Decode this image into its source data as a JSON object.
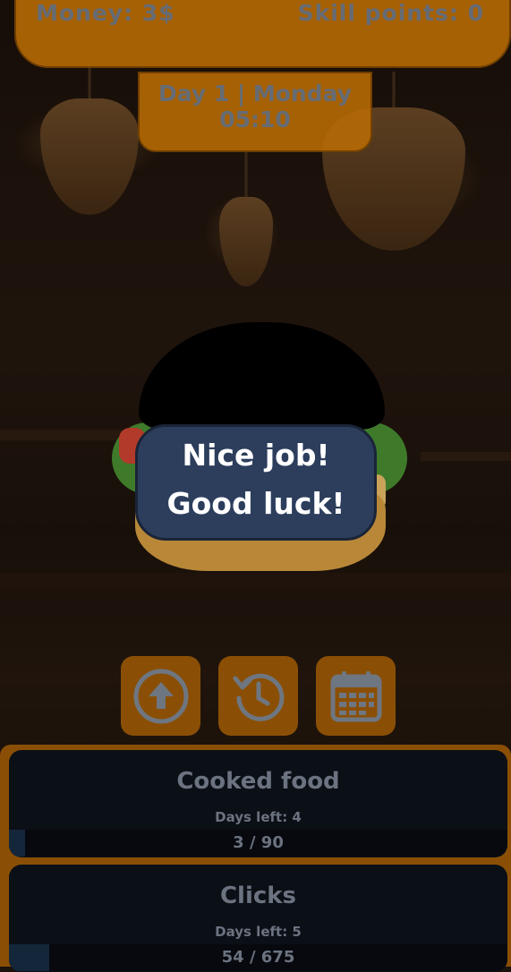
{
  "hud": {
    "money": "Money: 3$",
    "skill_points": "Skill points: 0",
    "day": "Day 1 | Monday",
    "time": "05:10"
  },
  "dialog": {
    "line1": "Nice job!",
    "line2": "Good luck!"
  },
  "actions": [
    {
      "name": "upgrade-button",
      "icon": "arrow-up-circle-icon"
    },
    {
      "name": "history-button",
      "icon": "history-clock-icon"
    },
    {
      "name": "calendar-button",
      "icon": "calendar-icon"
    }
  ],
  "goals": [
    {
      "title": "Cooked food",
      "days_left": "Days left: 4",
      "progress": "3 / 90",
      "fraction": 0.033
    },
    {
      "title": "Clicks",
      "days_left": "Days left: 5",
      "progress": "54 / 675",
      "fraction": 0.08
    }
  ],
  "colors": {
    "panel_orange": "#b66a05",
    "dialog_bg": "#2c3e5c",
    "goal_card_bg": "#0b0f16",
    "muted_text": "#6e7681"
  }
}
